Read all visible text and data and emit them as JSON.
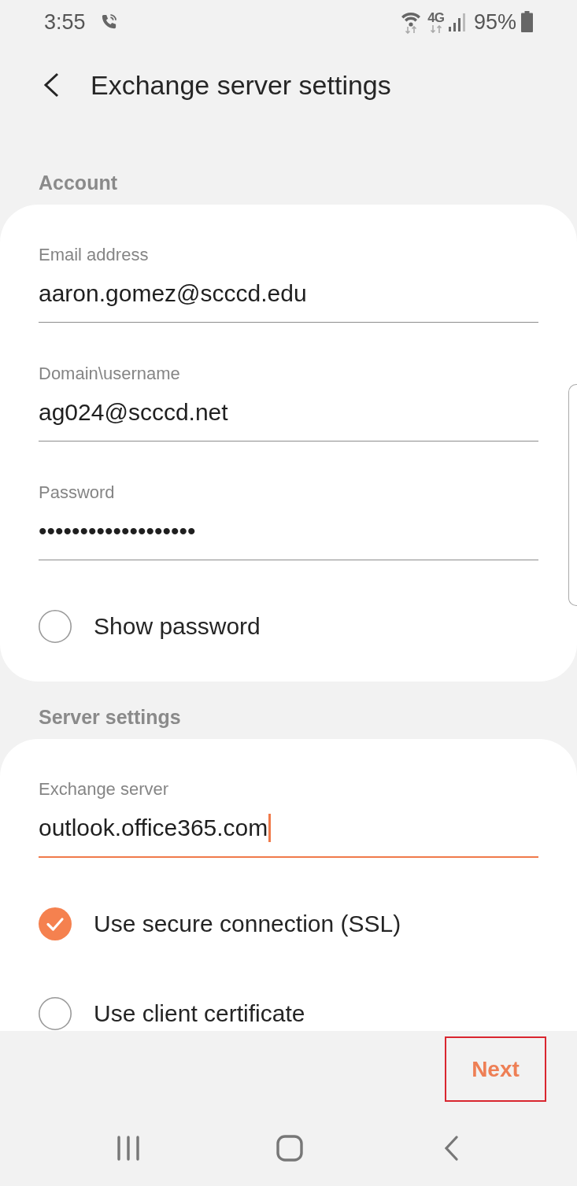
{
  "status_bar": {
    "time": "3:55",
    "network": "4G",
    "battery": "95%"
  },
  "header": {
    "title": "Exchange server settings"
  },
  "sections": [
    {
      "title": "Account",
      "fields": [
        {
          "label": "Email address",
          "value": "aaron.gomez@scccd.edu",
          "focused": false
        },
        {
          "label": "Domain\\username",
          "value": "ag024@scccd.net",
          "focused": false
        },
        {
          "label": "Password",
          "value": "•••••••••••••••••••",
          "focused": false
        }
      ],
      "options": [
        {
          "label": "Show password",
          "checked": false
        }
      ]
    },
    {
      "title": "Server settings",
      "fields": [
        {
          "label": "Exchange server",
          "value": "outlook.office365.com",
          "focused": true
        }
      ],
      "options": [
        {
          "label": "Use secure connection (SSL)",
          "checked": true
        },
        {
          "label": "Use client certificate",
          "checked": false
        }
      ]
    }
  ],
  "footer": {
    "next_button": {
      "label": "Next",
      "highlighted": true
    }
  }
}
